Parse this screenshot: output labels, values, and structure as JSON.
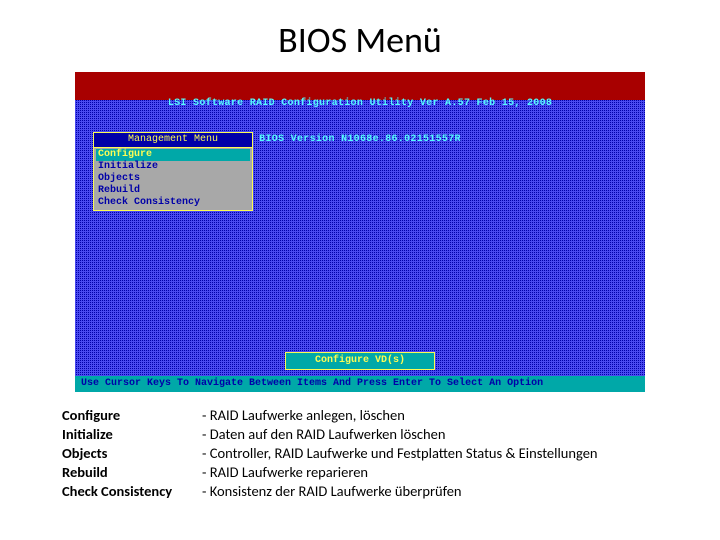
{
  "title": "BIOS Menü",
  "bios": {
    "header_line1": "LSI Software RAID Configuration Utility Ver A.57 Feb 15, 2008",
    "header_line2": "BIOS Version N1068e.86.02151557R",
    "menu_title": "Management Menu",
    "menu_items": [
      "Configure",
      "Initialize",
      "Objects",
      "Rebuild",
      "Check Consistency"
    ],
    "selected_index": 0,
    "hint": "Configure VD(s)",
    "footer": "Use Cursor Keys To Navigate Between Items And Press Enter To Select An Option"
  },
  "legend": [
    {
      "term": "Configure",
      "desc": "- RAID Laufwerke anlegen, löschen"
    },
    {
      "term": "Initialize",
      "desc": "- Daten auf den RAID Laufwerken löschen"
    },
    {
      "term": "Objects",
      "desc": "- Controller, RAID Laufwerke und Festplatten Status & Einstellungen"
    },
    {
      "term": "Rebuild",
      "desc": "- RAID Laufwerke reparieren"
    },
    {
      "term": "Check Consistency",
      "desc": "- Konsistenz der RAID Laufwerke überprüfen"
    }
  ]
}
